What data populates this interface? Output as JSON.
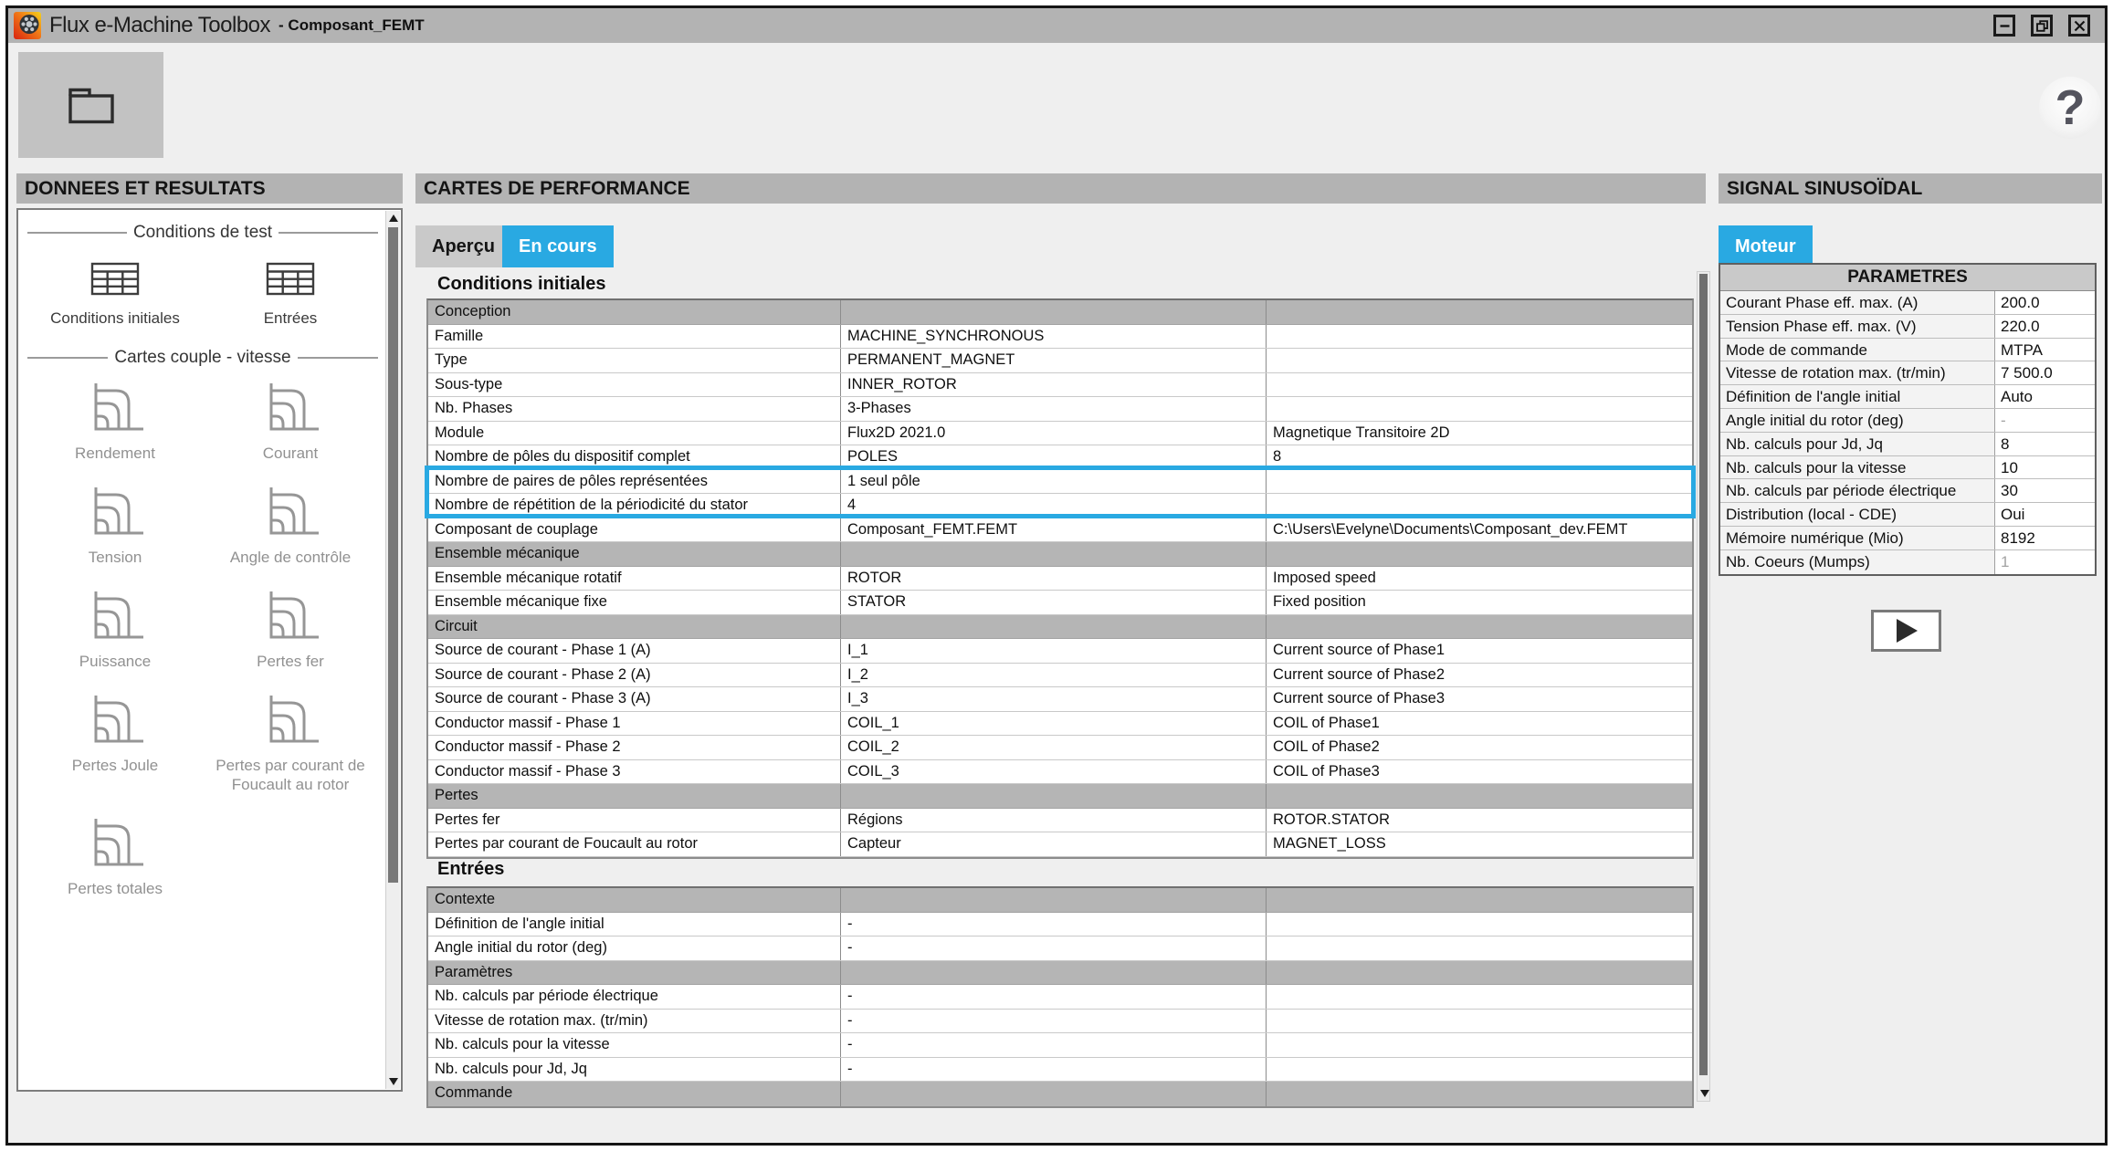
{
  "colors": {
    "accent": "#29a9e2",
    "titlebar": "#b3b3b3",
    "panelhdr": "#b3b3b3",
    "sectionrow": "#b5b5b5",
    "tabinactive": "#c9c9c9"
  },
  "window": {
    "title_app": "Flux e-Machine Toolbox",
    "title_doc": "- Composant_FEMT"
  },
  "toolbar": {
    "help": "?"
  },
  "left_panel": {
    "header": "DONNEES ET RESULTATS",
    "groups": [
      {
        "legend": "Conditions de test",
        "kind": "test",
        "items": [
          "Conditions initiales",
          "Entrées"
        ]
      },
      {
        "legend": "Cartes couple - vitesse",
        "kind": "map",
        "items": [
          "Rendement",
          "Courant",
          "Tension",
          "Angle de contrôle",
          "Puissance",
          "Pertes fer",
          "Pertes Joule",
          "Pertes par courant de Foucault au rotor",
          "Pertes totales"
        ]
      }
    ]
  },
  "center_panel": {
    "header": "CARTES DE PERFORMANCE",
    "tabs": [
      {
        "label": "Aperçu",
        "active": false
      },
      {
        "label": "En cours",
        "active": true
      }
    ],
    "tables": [
      {
        "title": "Conditions initiales",
        "rows": [
          {
            "type": "section",
            "c1": "Conception",
            "c2": "",
            "c3": ""
          },
          {
            "c1": "Famille",
            "c2": "MACHINE_SYNCHRONOUS",
            "c3": ""
          },
          {
            "c1": "Type",
            "c2": "PERMANENT_MAGNET",
            "c3": ""
          },
          {
            "c1": "Sous-type",
            "c2": "INNER_ROTOR",
            "c3": ""
          },
          {
            "c1": "Nb. Phases",
            "c2": "3-Phases",
            "c3": ""
          },
          {
            "c1": "Module",
            "c2": "Flux2D 2021.0",
            "c3": "Magnetique Transitoire 2D"
          },
          {
            "c1": "Nombre de pôles du dispositif complet",
            "c2": "POLES",
            "c3": "8"
          },
          {
            "c1": "Nombre de paires de pôles représentées",
            "c2": "1 seul pôle",
            "c3": "",
            "hl": true
          },
          {
            "c1": "Nombre de répétition de la périodicité du stator",
            "c2": "4",
            "c3": "",
            "hl": true
          },
          {
            "c1": "Composant de couplage",
            "c2": "Composant_FEMT.FEMT",
            "c3": "C:\\Users\\Evelyne\\Documents\\Composant_dev.FEMT"
          },
          {
            "type": "section",
            "c1": "Ensemble mécanique",
            "c2": "",
            "c3": ""
          },
          {
            "c1": "Ensemble mécanique rotatif",
            "c2": "ROTOR",
            "c3": "Imposed speed"
          },
          {
            "c1": "Ensemble mécanique fixe",
            "c2": "STATOR",
            "c3": "Fixed position"
          },
          {
            "type": "section",
            "c1": "Circuit",
            "c2": "",
            "c3": ""
          },
          {
            "c1": "Source de courant - Phase 1 (A)",
            "c2": "I_1",
            "c3": "Current source of Phase1"
          },
          {
            "c1": "Source de courant - Phase 2 (A)",
            "c2": "I_2",
            "c3": "Current source of Phase2"
          },
          {
            "c1": "Source de courant - Phase 3 (A)",
            "c2": "I_3",
            "c3": "Current source of Phase3"
          },
          {
            "c1": "Conductor massif - Phase 1",
            "c2": "COIL_1",
            "c3": "COIL of Phase1"
          },
          {
            "c1": "Conductor massif - Phase 2",
            "c2": "COIL_2",
            "c3": "COIL of Phase2"
          },
          {
            "c1": "Conductor massif - Phase 3",
            "c2": "COIL_3",
            "c3": "COIL of Phase3"
          },
          {
            "type": "section",
            "c1": "Pertes",
            "c2": "",
            "c3": ""
          },
          {
            "c1": "Pertes fer",
            "c2": "Régions",
            "c3": "ROTOR.STATOR"
          },
          {
            "c1": "Pertes par courant de Foucault au rotor",
            "c2": "Capteur",
            "c3": "MAGNET_LOSS"
          }
        ]
      },
      {
        "title": "Entrées",
        "rows": [
          {
            "type": "section",
            "c1": "Contexte",
            "c2": "",
            "c3": ""
          },
          {
            "c1": "Définition de l'angle initial",
            "c2": "-",
            "c3": ""
          },
          {
            "c1": "Angle initial du rotor (deg)",
            "c2": "-",
            "c3": ""
          },
          {
            "type": "section",
            "c1": "Paramètres",
            "c2": "",
            "c3": ""
          },
          {
            "c1": "Nb. calculs par période électrique",
            "c2": "-",
            "c3": ""
          },
          {
            "c1": "Vitesse de rotation max. (tr/min)",
            "c2": "-",
            "c3": ""
          },
          {
            "c1": "Nb. calculs pour la vitesse",
            "c2": "-",
            "c3": ""
          },
          {
            "c1": "Nb. calculs pour Jd, Jq",
            "c2": "-",
            "c3": ""
          },
          {
            "type": "section",
            "c1": "Commande",
            "c2": "",
            "c3": ""
          }
        ]
      }
    ]
  },
  "right_panel": {
    "header": "SIGNAL SINUSOÏDAL",
    "tab": "Moteur",
    "params": {
      "header": "PARAMETRES",
      "rows": [
        {
          "label": "Courant Phase eff. max. (A)",
          "value": "200.0"
        },
        {
          "label": "Tension Phase eff. max. (V)",
          "value": "220.0"
        },
        {
          "label": "Mode de commande",
          "value": "MTPA"
        },
        {
          "label": "Vitesse de rotation max. (tr/min)",
          "value": "7 500.0"
        },
        {
          "label": "Définition de l'angle initial",
          "value": "Auto"
        },
        {
          "label": "Angle initial du rotor (deg)",
          "value": "-",
          "disabled": true
        },
        {
          "label": "Nb. calculs pour Jd, Jq",
          "value": "8"
        },
        {
          "label": "Nb. calculs pour la vitesse",
          "value": "10"
        },
        {
          "label": "Nb. calculs par période électrique",
          "value": "30"
        },
        {
          "label": "Distribution (local - CDE)",
          "value": "Oui"
        },
        {
          "label": "Mémoire numérique (Mio)",
          "value": "8192"
        },
        {
          "label": "Nb. Coeurs (Mumps)",
          "value": "1",
          "disabled": true
        }
      ]
    }
  }
}
